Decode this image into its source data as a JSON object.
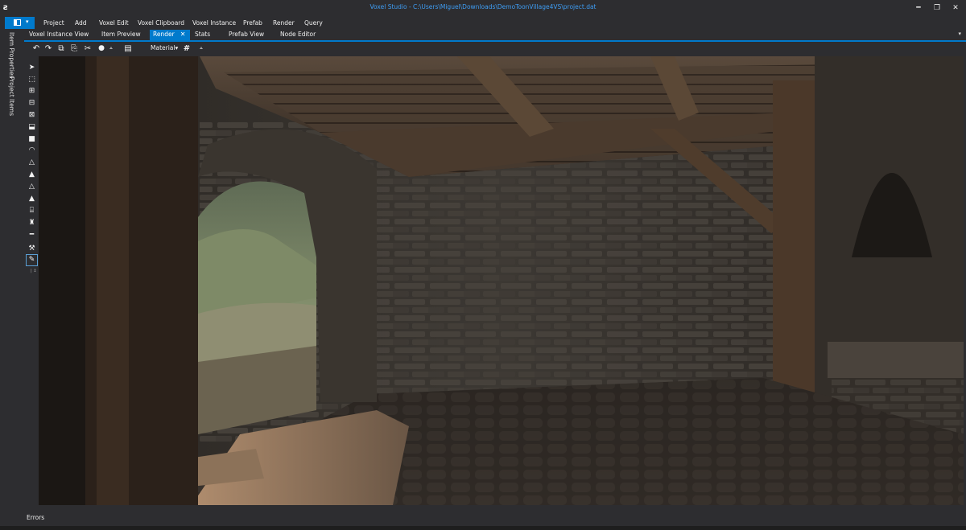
{
  "window": {
    "title": "Voxel Studio - C:\\Users\\Miguel\\Downloads\\DemoToonVillage4VS\\project.dat",
    "app_icon": "ƨ",
    "minimize": "━",
    "restore": "❐",
    "close": "✕"
  },
  "menu": {
    "file_caret": "▾",
    "items": [
      "Project",
      "Add",
      "Voxel Edit",
      "Voxel Clipboard",
      "Voxel Instance",
      "Prefab",
      "Render",
      "Query"
    ]
  },
  "tabs": {
    "items": [
      "Voxel Instance View",
      "Item Preview",
      "Render",
      "Stats",
      "Prefab View",
      "Node Editor"
    ],
    "active_index": 2,
    "close_glyph": "✕",
    "overflow": "▾"
  },
  "side_tabs": [
    "Item Properties",
    "Project Items"
  ],
  "toolbar": {
    "undo": "↶",
    "redo": "↷",
    "copy": "⧉",
    "paste": "⎘",
    "cut": "✂",
    "light": "●",
    "more": "⩡",
    "layers": "▤",
    "material_label": "Material",
    "material_caret": "▾",
    "grid": "#",
    "more2": "⩡"
  },
  "tools": {
    "select": "➤",
    "marquee": "⬚",
    "add": "⊞",
    "subtract": "⊟",
    "clear": "⊠",
    "stamp": "⬓",
    "fill": "■",
    "dome": "◠",
    "pyramid-dotted": "△",
    "cone": "▲",
    "pyramid": "△",
    "pyramid-stack": "▲",
    "column": "⌸",
    "tower": "♜",
    "line": "━",
    "hammer": "⚒",
    "eyedropper": "✎",
    "footnote": "| ↕"
  },
  "bottom": {
    "errors_label": "Errors"
  },
  "colors": {
    "accent": "#007acc",
    "chrome": "#2d2d30",
    "title_text": "#3e9cf2"
  }
}
